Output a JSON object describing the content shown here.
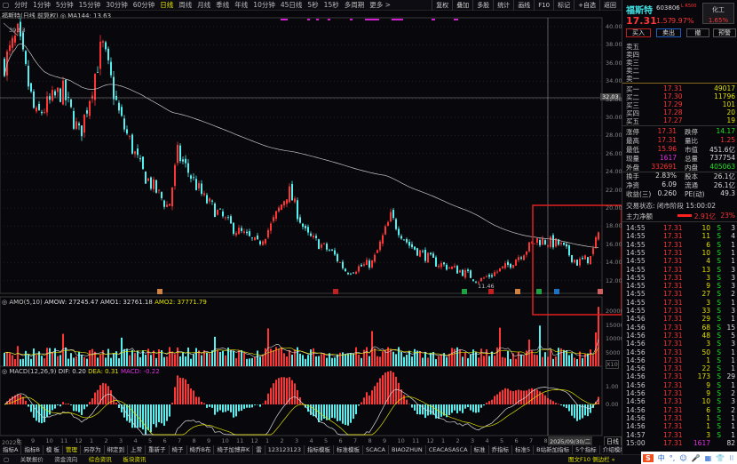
{
  "toolbar": {
    "periods": [
      "分时",
      "1分钟",
      "5分钟",
      "15分钟",
      "30分钟",
      "60分钟",
      "日线",
      "周线",
      "月线",
      "季线",
      "年线",
      "10分钟",
      "45日线",
      "5秒",
      "15秒",
      "多周期",
      "更多 >"
    ],
    "active": "日线",
    "tools": [
      "复权",
      "叠加",
      "多股",
      "统计",
      "画线",
      "F10",
      "标记",
      "+自选",
      "返回"
    ]
  },
  "chart": {
    "title": "福斯特(日线 前复权)",
    "ma_label": "MA144: 13.63",
    "max_label": "39.93",
    "min_label": "11.46",
    "crosshair_price": "32.03",
    "price_ticks": [
      "40.00",
      "38.00",
      "36.00",
      "34.00",
      "32.00",
      "30.00",
      "28.00",
      "26.00",
      "24.00",
      "22.00",
      "20.00",
      "18.00",
      "16.00",
      "14.00",
      "12.00"
    ],
    "volume": {
      "label": "AMO(5,10)",
      "amow": "AMOW: 27245.47",
      "amo1": "AMO1: 32761.18",
      "amo2": "AMO2: 37771.79",
      "ticks": [
        "20000",
        "15000",
        "10000",
        "5000"
      ],
      "unit": "X10"
    },
    "macd": {
      "label": "MACD(12,26,9)",
      "dif": "DIF: 0.20",
      "dea": "DEA: 0.31",
      "macd": "MACD: -0.22",
      "ticks": [
        "1.00",
        "0.00"
      ]
    },
    "dates": [
      "2022年",
      "8",
      "9",
      "10",
      "11",
      "12",
      "1",
      "2",
      "3",
      "4",
      "5",
      "6",
      "7",
      "8",
      "9",
      "10",
      "11",
      "12",
      "1",
      "2",
      "3",
      "4",
      "5",
      "6",
      "7",
      "8",
      "9",
      "10",
      "11",
      "12",
      "1",
      "2",
      "3",
      "4",
      "5",
      "6",
      "7",
      "8",
      "9"
    ],
    "cursor_date": "2025/09/30/二",
    "period_box": "日线",
    "zoom_in": "+",
    "zoom_out": "−",
    "colors": {
      "up": "#ff3434",
      "down": "#54f0f0",
      "ma": "#c8c8c8",
      "highlight": "#e02020"
    }
  },
  "quote": {
    "name": "福斯特",
    "code": "603806",
    "tag": "L R500",
    "sector": "化工",
    "sector_pct": "1.65%",
    "price": "17.31",
    "change": "1.57",
    "pct": "9.97%",
    "buttons": [
      "买入",
      "卖出",
      "撤",
      "预警"
    ],
    "asks": [
      {
        "label": "卖五"
      },
      {
        "label": "卖四"
      },
      {
        "label": "卖三"
      },
      {
        "label": "卖二"
      },
      {
        "label": "卖一"
      }
    ],
    "bids": [
      {
        "label": "买一",
        "price": "17.31",
        "vol": "49017"
      },
      {
        "label": "买二",
        "price": "17.30",
        "vol": "11796"
      },
      {
        "label": "买三",
        "price": "17.29",
        "vol": "101"
      },
      {
        "label": "买四",
        "price": "17.28",
        "vol": "20"
      },
      {
        "label": "买五",
        "price": "17.27",
        "vol": "19"
      }
    ],
    "stats": [
      [
        "涨停",
        "17.31",
        "跌停",
        "14.17"
      ],
      [
        "最高",
        "17.31",
        "量比",
        "1.25"
      ],
      [
        "最低",
        "15.96",
        "市值",
        "451.6亿"
      ],
      [
        "现量",
        "1617",
        "总量",
        "737754"
      ],
      [
        "外盘",
        "332691",
        "内盘",
        "405063"
      ],
      [
        "换手",
        "2.83%",
        "股本",
        "26.1亿"
      ],
      [
        "净资",
        "6.09",
        "流通",
        "26.1亿"
      ],
      [
        "收益(三)",
        "0.260",
        "PE(动)",
        "49.3"
      ]
    ],
    "status": "交易状态: 闭市阶段 15:00:02",
    "main_flow_label": "主力净额",
    "main_flow": "2.91亿",
    "main_flow_pct": "23%"
  },
  "ticks": [
    [
      "14:55",
      "17.31",
      "10",
      "S",
      "3"
    ],
    [
      "14:55",
      "17.31",
      "11",
      "S",
      "4"
    ],
    [
      "14:55",
      "17.31",
      "6",
      "S",
      "1"
    ],
    [
      "14:55",
      "17.31",
      "10",
      "S",
      "1"
    ],
    [
      "14:55",
      "17.31",
      "4",
      "S",
      "1"
    ],
    [
      "14:55",
      "17.31",
      "13",
      "S",
      "3"
    ],
    [
      "14:55",
      "17.31",
      "3",
      "S",
      "3"
    ],
    [
      "14:55",
      "17.31",
      "9",
      "S",
      "3"
    ],
    [
      "14:55",
      "17.31",
      "27",
      "S",
      "2"
    ],
    [
      "14:55",
      "17.31",
      "3",
      "S",
      "1"
    ],
    [
      "14:55",
      "17.31",
      "33",
      "S",
      "3"
    ],
    [
      "14:56",
      "17.31",
      "29",
      "S",
      "1"
    ],
    [
      "14:56",
      "17.31",
      "68",
      "S",
      "15"
    ],
    [
      "14:56",
      "17.31",
      "48",
      "S",
      "5"
    ],
    [
      "14:56",
      "17.31",
      "3",
      "S",
      "3"
    ],
    [
      "14:56",
      "17.31",
      "50",
      "S",
      "1"
    ],
    [
      "14:56",
      "17.31",
      "1",
      "S",
      "1"
    ],
    [
      "14:56",
      "17.31",
      "22",
      "S",
      "1"
    ],
    [
      "14:56",
      "17.31",
      "173",
      "S",
      "29"
    ],
    [
      "14:56",
      "17.31",
      "9",
      "S",
      "1"
    ],
    [
      "14:56",
      "17.31",
      "9",
      "S",
      "2"
    ],
    [
      "14:56",
      "17.31",
      "10",
      "S",
      "3"
    ],
    [
      "14:56",
      "17.31",
      "6",
      "S",
      "2"
    ],
    [
      "14:56",
      "17.31",
      "1",
      "S",
      "1"
    ],
    [
      "14:56",
      "17.31",
      "1",
      "S",
      "1"
    ],
    [
      "14:57",
      "17.31",
      "3",
      "S",
      "1"
    ],
    [
      "15:00",
      "17.31",
      "1617",
      "",
      "82"
    ]
  ],
  "indicator_tabs": [
    "指标A",
    "指标B",
    "模 板",
    "管理",
    "另存为",
    "绑定到",
    "上常",
    "重新子",
    "椅子",
    "椅乔B布",
    "椅子加博弃K",
    "雷",
    "123123123",
    "指标模板",
    "标准模板",
    "SCACA",
    "BIAOZHUN",
    "CEACASASCA",
    "标准",
    "乔指标",
    "标准5",
    "B站新加指标",
    "5个指标",
    "介绍模版"
  ],
  "indicator_active": "管理",
  "bottom": {
    "items": [
      "关联报价",
      "资金流向",
      "综合资讯",
      "板块资讯"
    ],
    "right": "图文F10 侧边栏 «"
  },
  "ime": [
    "S",
    "中",
    "°,",
    "☺",
    "🎤",
    "▦",
    "👕",
    "⁝⁝"
  ]
}
